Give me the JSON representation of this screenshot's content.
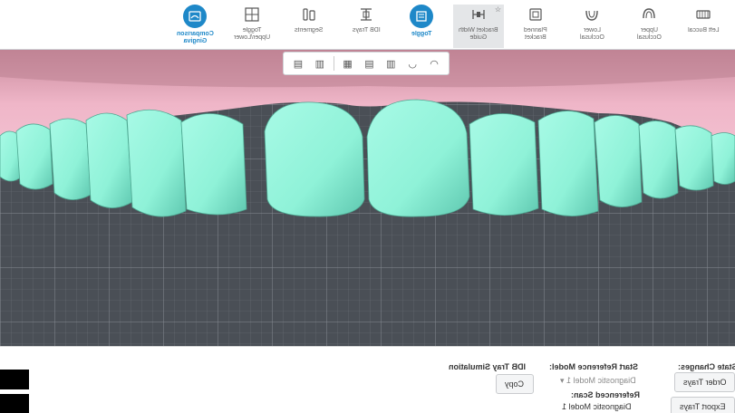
{
  "toolbar": {
    "items": [
      {
        "label": "Comparison\nGingiva",
        "icon": "comparison-gingiva-icon",
        "active": true
      },
      {
        "label": "Toggle\nUpper/Lower",
        "icon": "toggle-upper-lower-icon"
      },
      {
        "label": "Segments",
        "icon": "segments-icon"
      },
      {
        "label": "IDB Trays",
        "icon": "idb-trays-icon"
      },
      {
        "label": "Toggle",
        "icon": "toggle-icon",
        "active": true
      },
      {
        "label": "Bracket Width\nGuide",
        "icon": "bracket-width-guide-icon",
        "pressed": true
      },
      {
        "label": "Planned\nBracket",
        "icon": "planned-bracket-icon"
      },
      {
        "label": "Lower\nOcclusal",
        "icon": "lower-occlusal-icon"
      },
      {
        "label": "Upper\nOcclusal",
        "icon": "upper-occlusal-icon"
      },
      {
        "label": "Left Buccal",
        "icon": "left-buccal-icon"
      }
    ]
  },
  "colors": {
    "accent": "#1e88c8",
    "teeth": "#8ff2d8",
    "gingiva": "#efb6c8",
    "grid_bg": "#4a4f56"
  },
  "panel": {
    "idb_title": "IDB Tray Simulation",
    "copy_label": "Copy",
    "start_ref_title": "Start Reference Model:",
    "start_ref_value": "Diagnostic Model 1",
    "referenced_scan_title": "Referenced Scan:",
    "referenced_scan_value": "Diagnostic Model 1",
    "state_title": "State Changes:",
    "order_trays_label": "Order Trays",
    "export_trays_label": "Export Trays"
  }
}
